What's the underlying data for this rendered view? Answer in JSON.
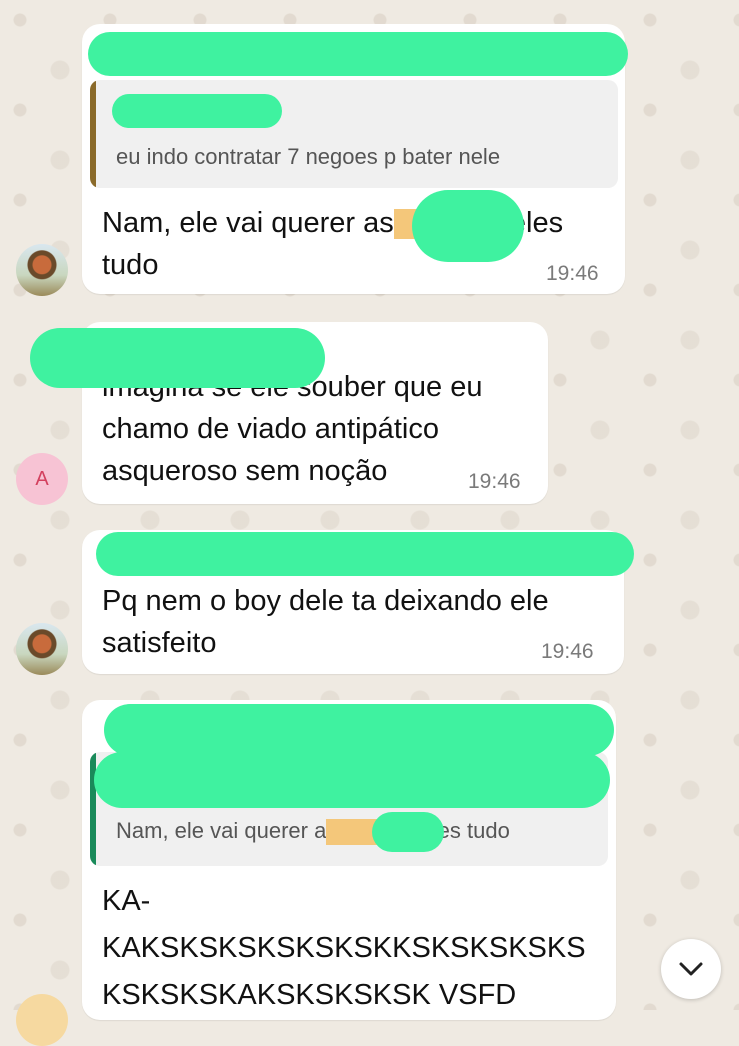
{
  "messages": [
    {
      "quote_text": "eu indo contratar 7 negoes p bater nele",
      "text_part1": "Nam, ele vai querer as",
      "text_part2": "deles",
      "text_line2": "tudo",
      "time": "19:46"
    },
    {
      "text_line1": "imagina se ele souber que eu",
      "text_line2": "chamo de viado antipático",
      "text_line3": "asqueroso sem noção",
      "time": "19:46",
      "avatar_letter": "A"
    },
    {
      "text_line1": "Pq nem o boy dele ta deixando ele",
      "text_line2": "satisfeito",
      "time": "19:46"
    },
    {
      "quote_text_part1": "Nam, ele vai querer a",
      "quote_text_part2": "deles tudo",
      "text_line1": "KA-",
      "text_line2": "KAKSKSKSKSKSKSKKSKSKSKSKS",
      "text_line3": "KSKSKSKAKSKSKSKSK VSFD"
    }
  ],
  "colors": {
    "redaction": "#3ff2a0",
    "quote_bar_1": "#8a6a2a",
    "quote_bar_4": "#1a8a5a"
  },
  "scroll_button": {
    "icon": "chevron-down-icon"
  }
}
